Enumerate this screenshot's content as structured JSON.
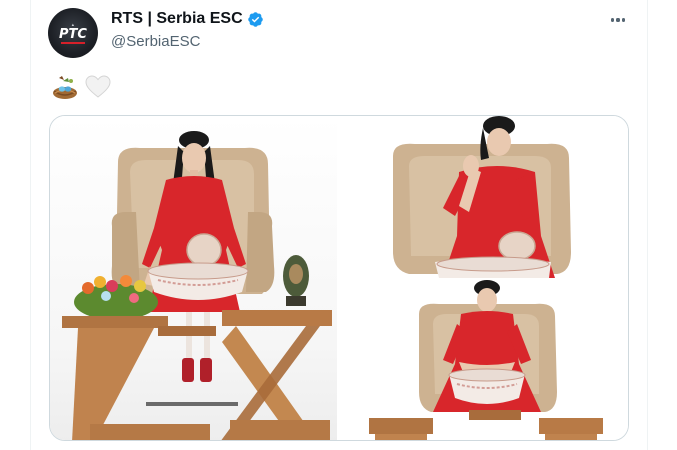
{
  "tweet": {
    "author": {
      "display_name": "RTS | Serbia ESC",
      "handle": "@SerbiaESC",
      "verified": true,
      "avatar_logo_text": "РТС"
    },
    "body_emojis": [
      "bird-nest-emoji",
      "white-heart-emoji"
    ],
    "more_icon": "more-horizontal-icon",
    "media": [
      {
        "name": "photo-woman-in-chair-with-tables"
      },
      {
        "name": "photo-woman-hands-raised"
      },
      {
        "name": "photo-woman-with-basin"
      }
    ]
  },
  "colors": {
    "verified_blue": "#1d9bf0",
    "text_primary": "#0f1419",
    "text_secondary": "#536471",
    "dress_red": "#d8262b",
    "chair_beige": "#cdb291",
    "wood": "#b07442"
  }
}
